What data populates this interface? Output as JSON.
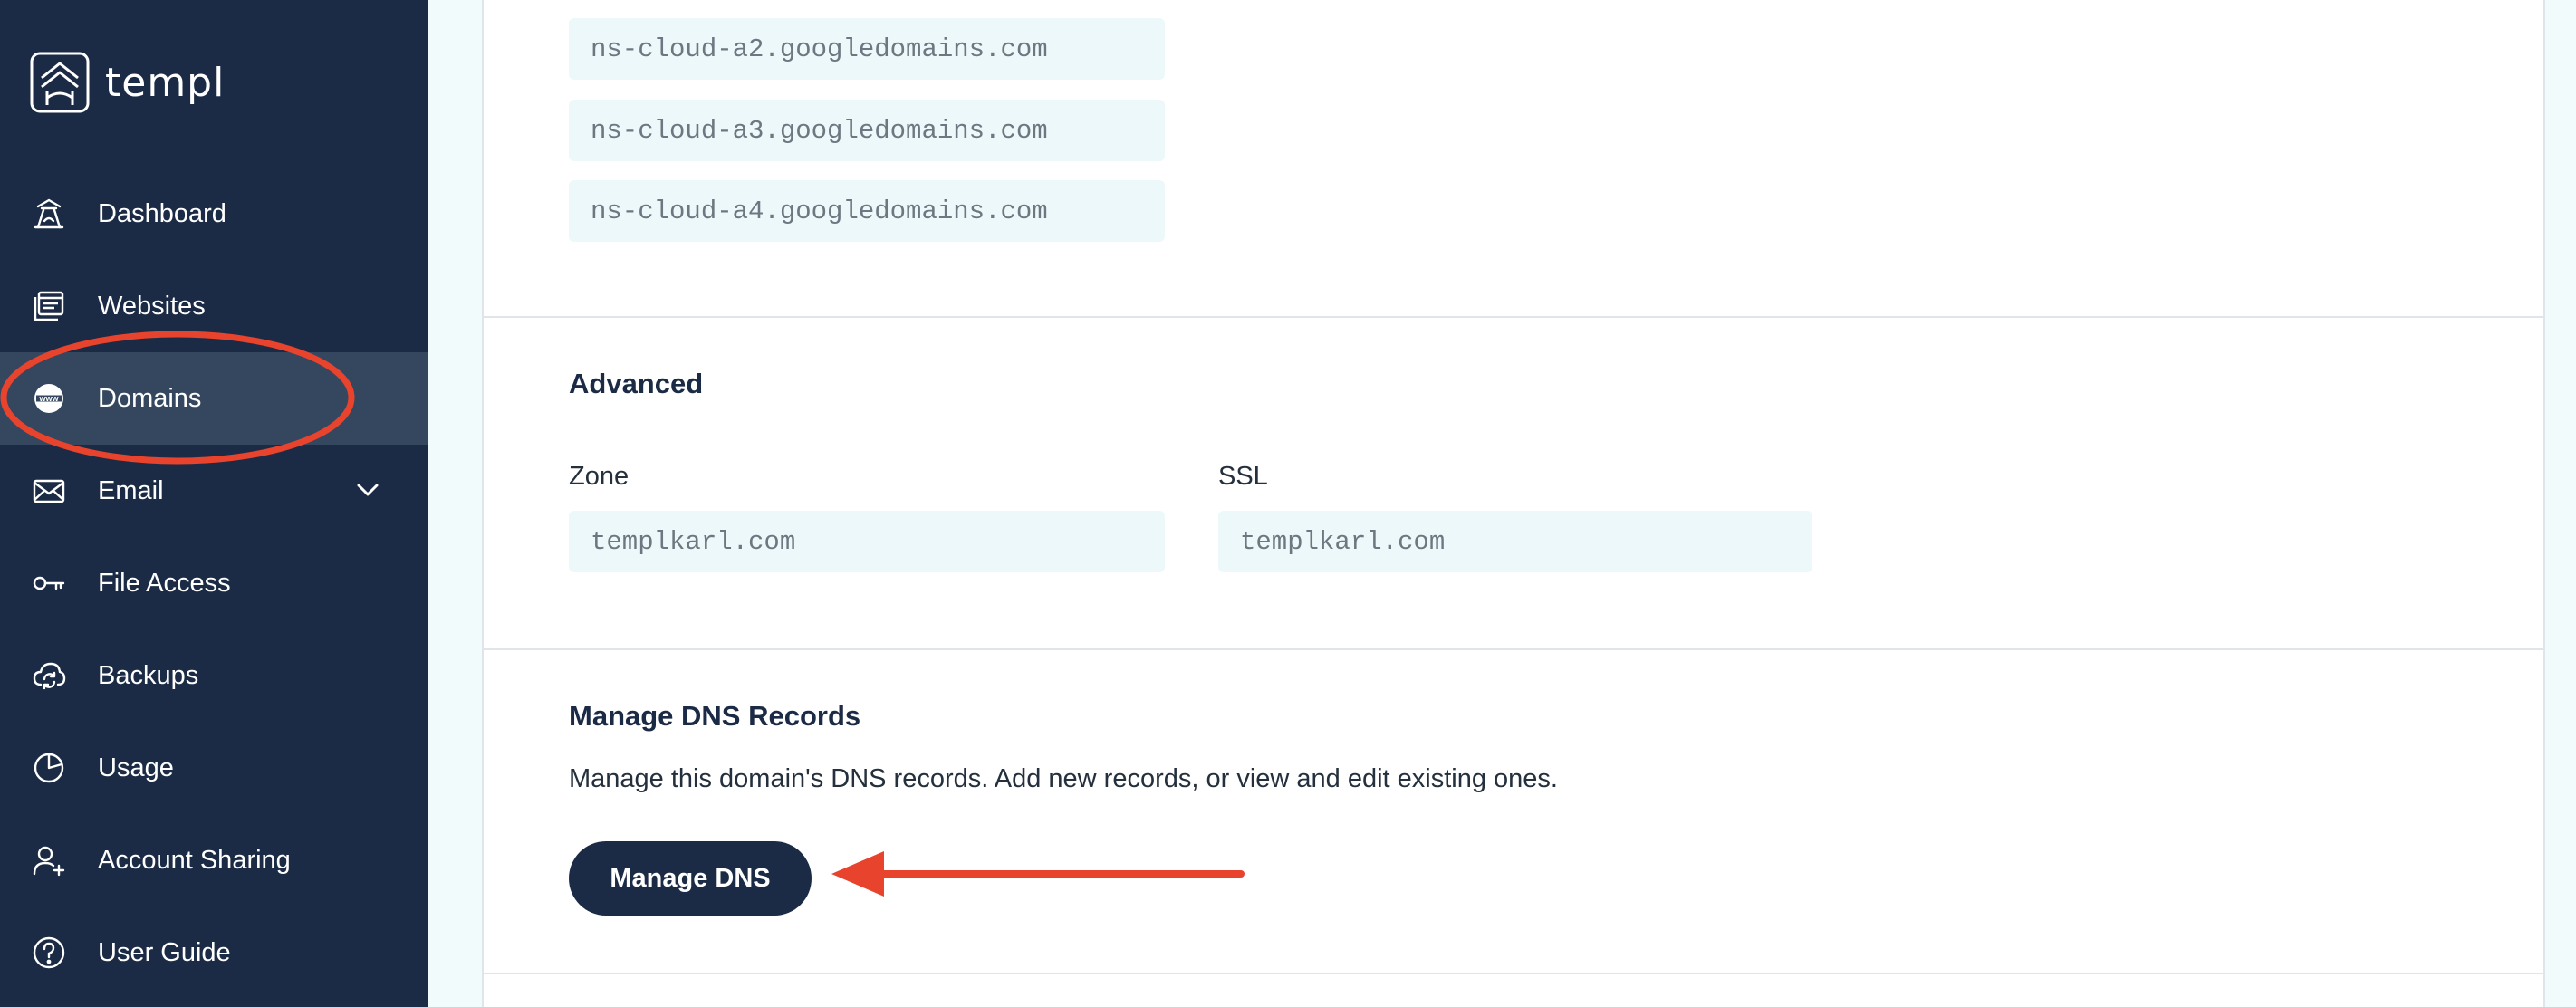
{
  "app": {
    "brand": "templ"
  },
  "sidebar": {
    "items": [
      {
        "label": "Dashboard",
        "icon": "dashboard-icon",
        "active": false
      },
      {
        "label": "Websites",
        "icon": "websites-icon",
        "active": false
      },
      {
        "label": "Domains",
        "icon": "globe-www-icon",
        "active": true
      },
      {
        "label": "Email",
        "icon": "envelope-icon",
        "active": false,
        "has_submenu": true
      },
      {
        "label": "File Access",
        "icon": "key-icon",
        "active": false
      },
      {
        "label": "Backups",
        "icon": "cloud-sync-icon",
        "active": false
      },
      {
        "label": "Usage",
        "icon": "pie-chart-icon",
        "active": false
      },
      {
        "label": "Account Sharing",
        "icon": "user-add-icon",
        "active": false
      },
      {
        "label": "User Guide",
        "icon": "help-circle-icon",
        "active": false
      }
    ]
  },
  "nameservers": [
    "ns-cloud-a2.googledomains.com",
    "ns-cloud-a3.googledomains.com",
    "ns-cloud-a4.googledomains.com"
  ],
  "advanced": {
    "title": "Advanced",
    "zone_label": "Zone",
    "zone_value": "templkarl.com",
    "ssl_label": "SSL",
    "ssl_value": "templkarl.com"
  },
  "dns": {
    "title": "Manage DNS Records",
    "description": "Manage this domain's DNS records. Add new records, or view and edit existing ones.",
    "button_label": "Manage DNS"
  },
  "colors": {
    "sidebar_bg": "#1b2b45",
    "sidebar_active": "#34475f",
    "field_bg": "#ecf8f9",
    "annotation": "#e8432d"
  }
}
